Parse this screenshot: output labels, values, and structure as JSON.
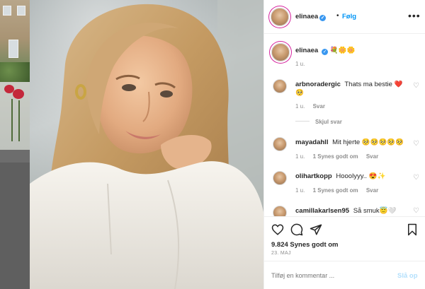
{
  "post": {
    "author": "elinaea",
    "dot": "•",
    "follow_label": "Følg",
    "more_label": "•••",
    "caption_emojis": "💐🌼🌼",
    "caption_time": "1 u.",
    "likes": "9.824 Synes godt om",
    "date": "23. MAJ",
    "verified_mark": "✓"
  },
  "comments": [
    {
      "user": "arbnoradergic",
      "text": "Thats ma bestie ❤️ 🥺",
      "time": "1 u.",
      "reply_label": "Svar",
      "likes_label": ""
    },
    {
      "user": "mayadahll",
      "text": "Mit hjerte 🥺🥺🥺🥺🥺",
      "time": "1 u.",
      "reply_label": "Svar",
      "likes_label": "1 Synes godt om"
    },
    {
      "user": "olihartkopp",
      "text": "Hooolyyy.. 😍✨",
      "time": "1 u.",
      "reply_label": "Svar",
      "likes_label": "1 Synes godt om"
    },
    {
      "user": "camillakarlsen95",
      "text": "Så smuk😇🤍",
      "time": "",
      "reply_label": "",
      "likes_label": ""
    }
  ],
  "hide_replies_label": "Skjul svar",
  "add_comment": {
    "placeholder": "Tilføj en kommentar ...",
    "post_label": "Slå op"
  },
  "icons": {
    "like": "heart-icon",
    "comment": "comment-icon",
    "share": "share-icon",
    "save": "bookmark-icon",
    "comment_like": "heart-icon"
  },
  "colors": {
    "link_blue": "#0095f6",
    "verified_blue": "#3897f0",
    "muted_text": "#8e8e8e",
    "post_disabled": "#b2dffc"
  }
}
